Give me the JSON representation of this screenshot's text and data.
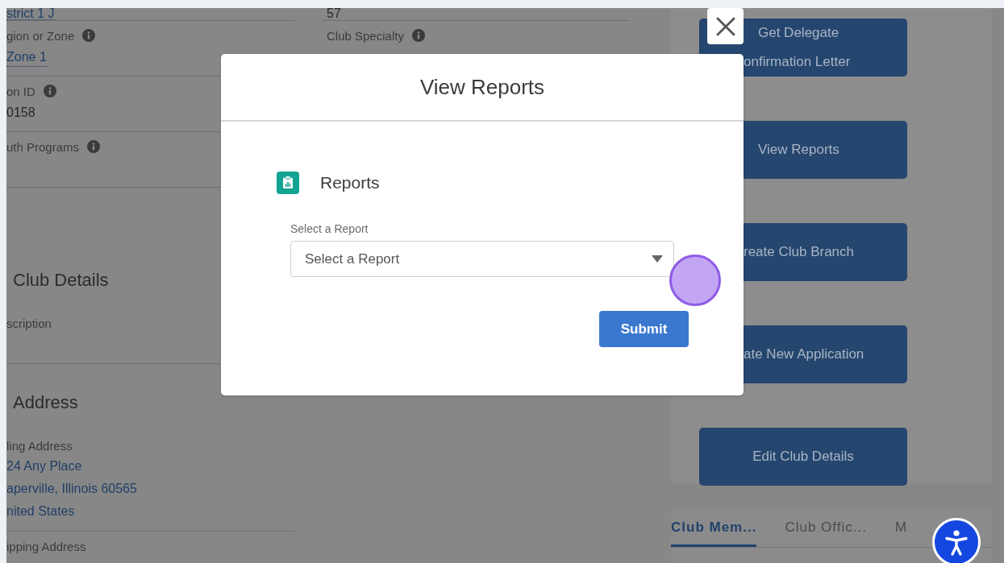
{
  "record": {
    "left_column": [
      {
        "fields": [
          {
            "value": "strict 1 J",
            "link": true
          },
          {
            "label": "gion or Zone",
            "info": true,
            "value": "Zone 1",
            "link": true
          },
          {
            "label": "on ID",
            "info": true,
            "value": "0158"
          },
          {
            "label": "uth Programs",
            "info": true
          }
        ]
      },
      {
        "heading": "Club Details",
        "fields": [
          {
            "label": "scription"
          }
        ]
      },
      {
        "heading": "Address",
        "fields": [
          {
            "label": "ling Address",
            "value_lines": [
              "24 Any Place",
              "aperville, Illinois 60565",
              "nited States"
            ],
            "link": true
          },
          {
            "label": "ipping Address"
          }
        ]
      }
    ],
    "middle_column": [
      {
        "value": "57"
      },
      {
        "label": "Club Specialty",
        "info": true
      }
    ]
  },
  "actions": {
    "buttons": [
      {
        "lines": [
          "Get Delegate",
          "onfirmation Letter"
        ]
      },
      {
        "lines": [
          "View Reports"
        ]
      },
      {
        "lines": [
          "reate Club Branch"
        ]
      },
      {
        "lines": [
          "ate New Application"
        ]
      },
      {
        "lines": [
          "Edit Club Details"
        ]
      }
    ]
  },
  "related_tabs": [
    {
      "label": "Club Mem...",
      "selected": true
    },
    {
      "label": "Club Offic...",
      "selected": false
    },
    {
      "label": "M",
      "selected": false
    }
  ],
  "modal": {
    "title": "View Reports",
    "section_title": "Reports",
    "field_label": "Select a Report",
    "select": {
      "placeholder": "Select a Report"
    },
    "submit": "Submit"
  }
}
